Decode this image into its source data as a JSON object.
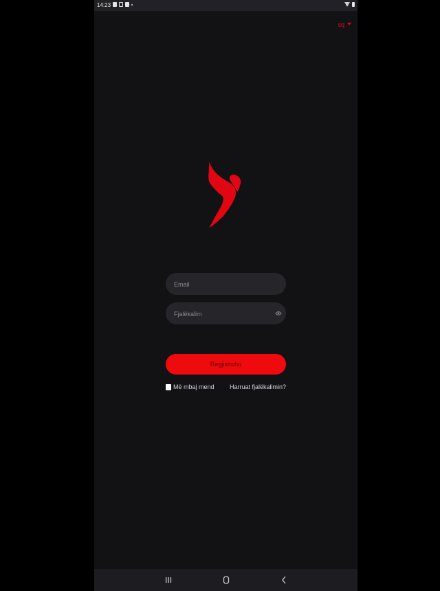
{
  "status_bar": {
    "time": "14:23"
  },
  "language": {
    "code": "sq",
    "color": "#e10712"
  },
  "login": {
    "email_placeholder": "Email",
    "password_placeholder": "Fjalëkalim",
    "register_label": "Regjistrohu",
    "remember_label": "Më mbaj mend",
    "forgot_label": "Harruat fjalëkalimin?"
  },
  "colors": {
    "background": "#121215",
    "accent": "#ee0a0d",
    "field": "#26262a"
  },
  "icons": {
    "password_toggle": "eye-icon",
    "nav_recent": "recent-apps-icon",
    "nav_home": "home-icon",
    "nav_back": "back-icon"
  }
}
